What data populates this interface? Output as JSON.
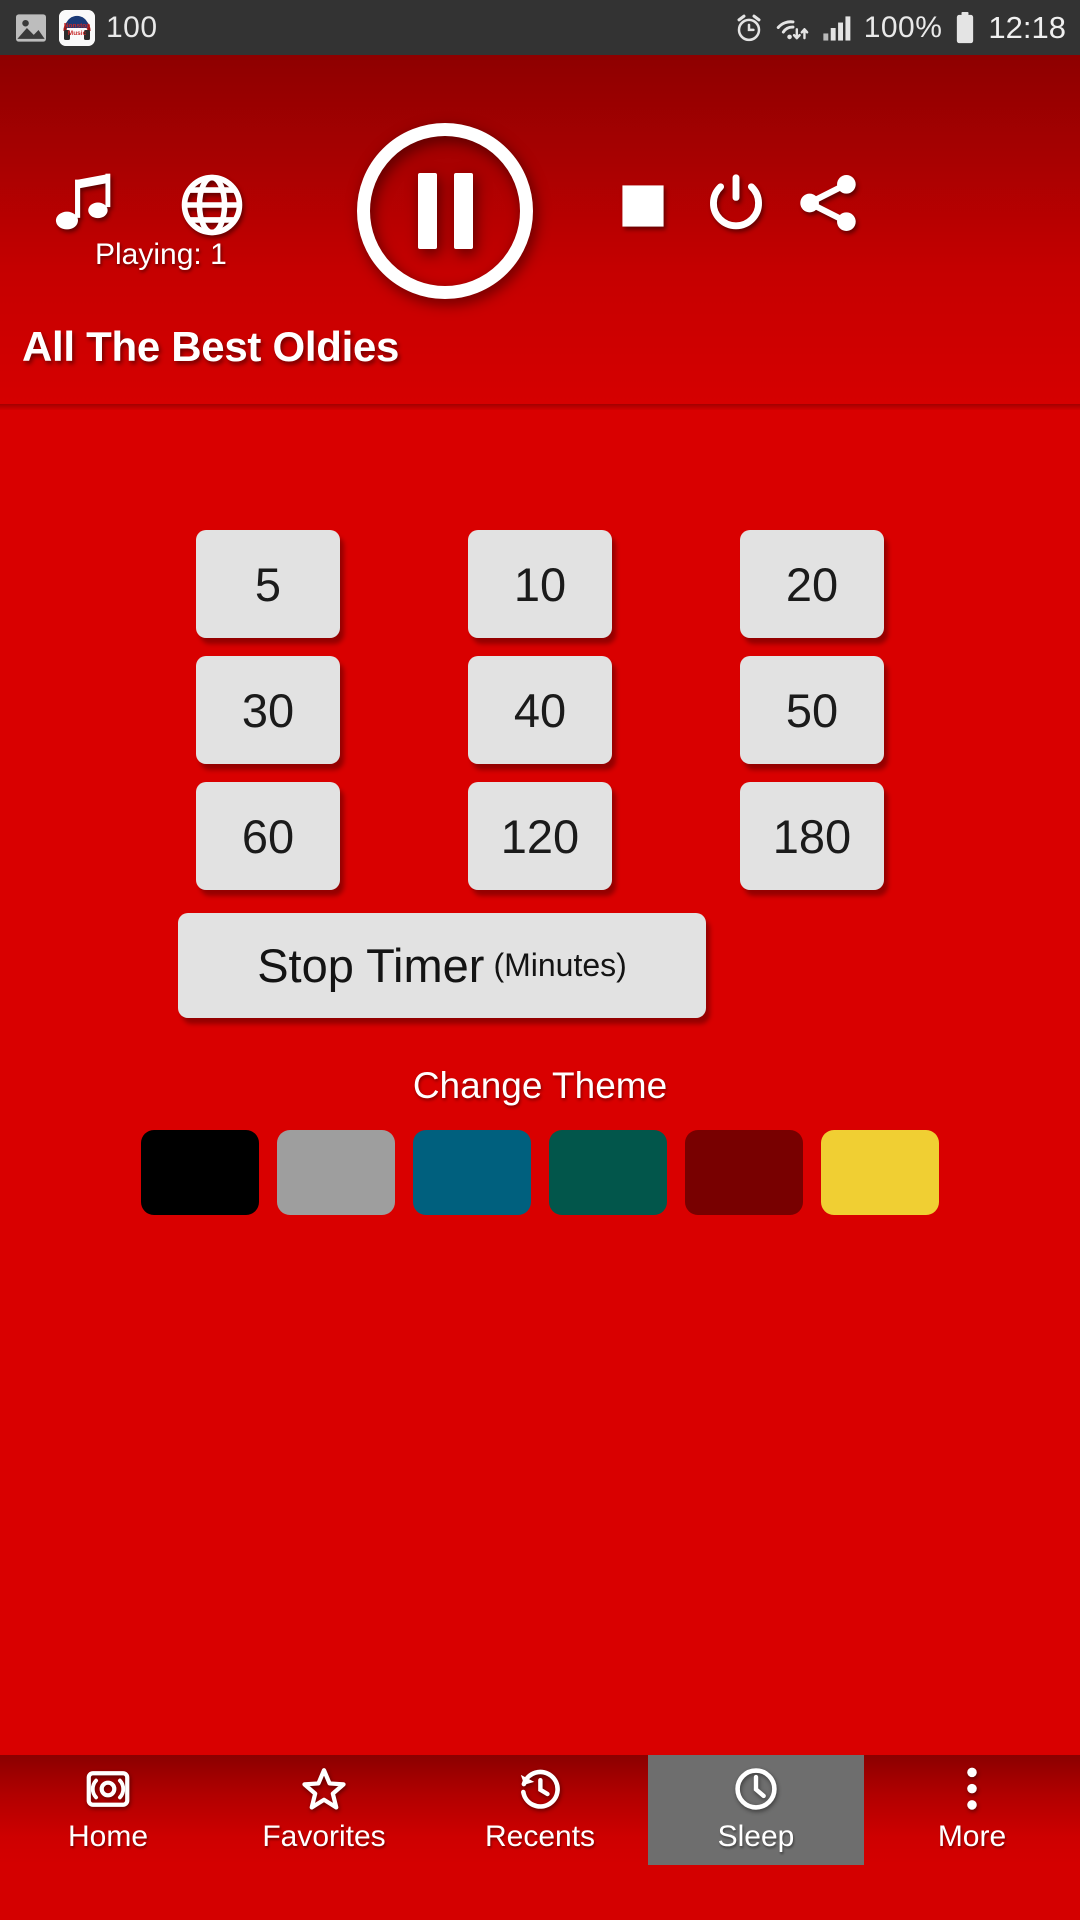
{
  "status_bar": {
    "left_icons": [
      "image-icon",
      "app-notification-icon"
    ],
    "notification_count": "100",
    "right_icons": [
      "alarm-icon",
      "wifi-icon",
      "signal-icon",
      "battery-icon"
    ],
    "battery_percent": "100%",
    "time": "12:18"
  },
  "header": {
    "music_icon": "music-note-icon",
    "globe_icon": "globe-icon",
    "playing_label": "Playing: 1",
    "play_pause_icon": "pause-icon",
    "stop_icon": "stop-icon",
    "power_icon": "power-icon",
    "share_icon": "share-icon",
    "station_title": "All The Best Oldies"
  },
  "sleep_timer": {
    "rows": [
      [
        "5",
        "10",
        "20"
      ],
      [
        "30",
        "40",
        "50"
      ],
      [
        "60",
        "120",
        "180"
      ]
    ],
    "stop_button_main": "Stop Timer",
    "stop_button_sub": "(Minutes)"
  },
  "theme": {
    "label": "Change Theme",
    "swatches": [
      {
        "name": "black",
        "color": "#000000"
      },
      {
        "name": "gray",
        "color": "#9E9E9E"
      },
      {
        "name": "teal",
        "color": "#00607E"
      },
      {
        "name": "green",
        "color": "#02564B"
      },
      {
        "name": "maroon",
        "color": "#780000"
      },
      {
        "name": "yellow",
        "color": "#F0CF33"
      }
    ]
  },
  "bottom_nav": {
    "items": [
      {
        "label": "Home",
        "icon": "radio-icon",
        "active": false
      },
      {
        "label": "Favorites",
        "icon": "star-icon",
        "active": false
      },
      {
        "label": "Recents",
        "icon": "history-clock-icon",
        "active": false
      },
      {
        "label": "Sleep",
        "icon": "clock-icon",
        "active": true
      },
      {
        "label": "More",
        "icon": "overflow-dots-icon",
        "active": false
      }
    ]
  },
  "colors": {
    "brand_red": "#D90000",
    "header_dark_red": "#8E0000",
    "button_gray": "#E2E2E2",
    "active_tab_gray": "#6E6E6E",
    "status_bar": "#333333"
  }
}
